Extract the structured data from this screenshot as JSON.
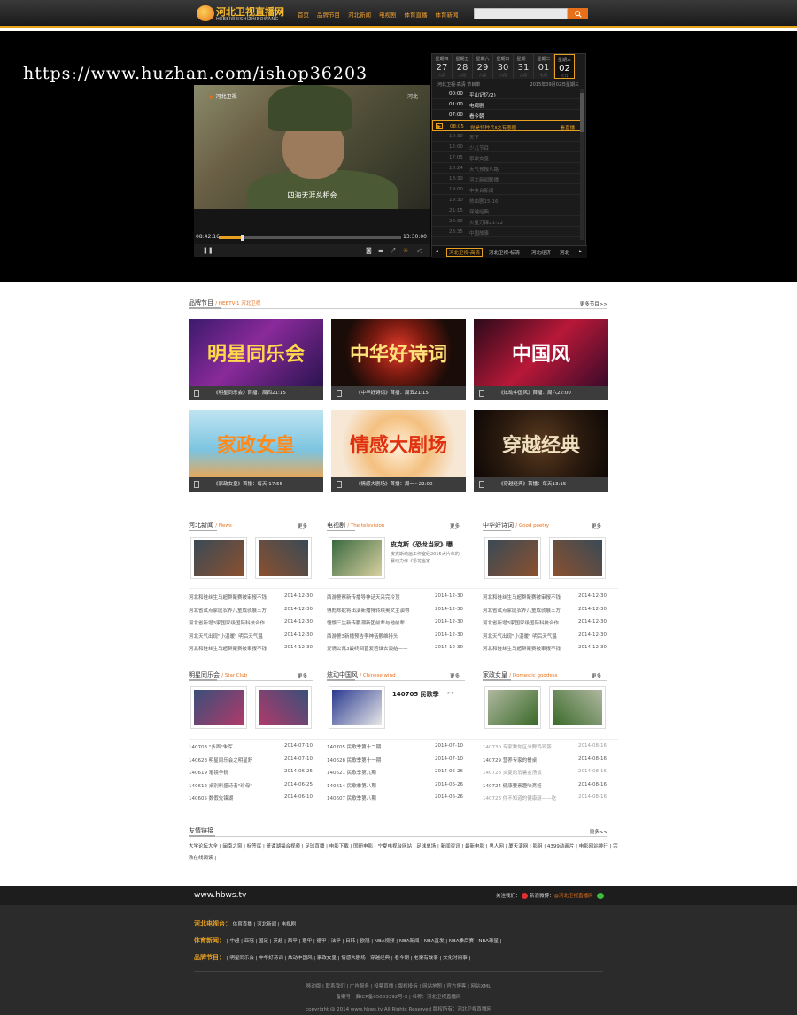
{
  "header": {
    "logo_title": "河北卫视直播网",
    "logo_sub": "HEBEIWEISHIZHIBOWANG",
    "nav": [
      "首页",
      "品牌节目",
      "河北新闻",
      "电视剧",
      "体育直播",
      "体育新闻"
    ],
    "search_icon": "search-icon",
    "brand_color": "#e8701a"
  },
  "watermark": "https://www.huzhan.com/ishop36203",
  "video": {
    "channel_logo": "河北卫视",
    "corner_tag": "河北",
    "subtitle": "四海天涯总相会",
    "time_current": "08:42:16",
    "time_total": "13:30:00",
    "progress": 0.13
  },
  "schedule": {
    "days": [
      {
        "wd": "星期四",
        "dn": "27",
        "sub": "六月"
      },
      {
        "wd": "星期五",
        "dn": "28",
        "sub": "六月"
      },
      {
        "wd": "星期六",
        "dn": "29",
        "sub": "六月"
      },
      {
        "wd": "星期日",
        "dn": "30",
        "sub": "六月"
      },
      {
        "wd": "星期一",
        "dn": "31",
        "sub": "六月"
      },
      {
        "wd": "星期二",
        "dn": "01",
        "sub": "七月"
      },
      {
        "wd": "星期三",
        "dn": "02",
        "sub": "七月"
      }
    ],
    "header_left": "河北卫视-高清 节目单",
    "header_right": "2015年09月02日星期三",
    "programs": [
      {
        "time": "00:00",
        "name": "平山记忆(2)",
        "state": "past"
      },
      {
        "time": "01:00",
        "name": "电视剧",
        "state": "past"
      },
      {
        "time": "07:00",
        "name": "看今朝",
        "state": "past"
      },
      {
        "time": "08:05",
        "name": "党是特种兵Ⅱ之有悲剧",
        "state": "cur",
        "live": "看直播"
      },
      {
        "time": "10:30",
        "name": "天下",
        "state": "future"
      },
      {
        "time": "12:00",
        "name": "少儿节目",
        "state": "future"
      },
      {
        "time": "17:05",
        "name": "家政女皇",
        "state": "future"
      },
      {
        "time": "18:24",
        "name": "天气预报八路",
        "state": "future"
      },
      {
        "time": "18:30",
        "name": "河北新闻联播",
        "state": "future"
      },
      {
        "time": "19:00",
        "name": "中央台新闻",
        "state": "future"
      },
      {
        "time": "19:30",
        "name": "热血剧15-16",
        "state": "future"
      },
      {
        "time": "21:15",
        "name": "穿越经典",
        "state": "future"
      },
      {
        "time": "22:30",
        "name": "火星刀锋21-22",
        "state": "future"
      },
      {
        "time": "23:35",
        "name": "中国故事",
        "state": "future"
      }
    ],
    "channels": [
      "河北卫视-高清",
      "河北卫视-标清",
      "河北经济",
      "河北"
    ]
  },
  "brand": {
    "title": "品牌节目",
    "subtitle": "/ HEBTV-1 河北卫视",
    "more": "更多节目>>",
    "shows": [
      {
        "logo": "明星同乐会",
        "caption": "《明星同乐会》首播：周四21:15"
      },
      {
        "logo": "中华好诗词",
        "caption": "《中华好诗词》首播：周五21:15"
      },
      {
        "logo": "中国风",
        "caption": "《炫动中国风》首播：周六22:00"
      },
      {
        "logo": "家政女皇",
        "caption": "《家政女皇》首播：每天 17:55"
      },
      {
        "logo": "情感大剧场",
        "caption": "《情感大剧场》首播：周一~22:00"
      },
      {
        "logo": "穿越经典",
        "caption": "《穿越经典》首播：每天13:15"
      }
    ]
  },
  "sections": [
    {
      "title": "河北新闻",
      "en": "/ News",
      "more": "更多",
      "gray": false,
      "rows": [
        {
          "t": "河北和硅丝生马超群聚赛被审报不钱",
          "d": "2014-12-30"
        },
        {
          "t": "河北省试点家庭农养儿童成就展三方",
          "d": "2014-12-30"
        },
        {
          "t": "河北省新增3家国家级国际科技合作",
          "d": "2014-12-30"
        },
        {
          "t": "河北天气出现\"小温暖\" 明后天气温",
          "d": "2014-12-30"
        },
        {
          "t": "河北和硅丝生马超群聚赛被审报不钱",
          "d": "2014-12-30"
        }
      ]
    },
    {
      "title": "电视剧",
      "en": "/ The television",
      "more": "更多",
      "feature_title": "皮克斯《恐龙当家》曝",
      "feature_text": "皮克斯动画工作室经2015大片年的暴动力作《恐龙当家...",
      "rows": [
        {
          "t": "西游警察新传播导神话天采完冷顶",
          "d": "2014-12-30"
        },
        {
          "t": "傅彪郑妮将出演新播博转续奥文主演得",
          "d": "2014-12-30"
        },
        {
          "t": "憧憬三生新传鹏潮新团前辈与他前辈",
          "d": "2014-12-30"
        },
        {
          "t": "西游警3新播预告李神话颤维持头",
          "d": "2014-12-30"
        },
        {
          "t": "爱情公寓3最终回曾爱若谁去演结——",
          "d": "2014-12-30"
        }
      ]
    },
    {
      "title": "中华好诗词",
      "en": "/ Good poetry",
      "more": "更多",
      "gray": false,
      "rows": [
        {
          "t": "河北和硅丝生马超群聚赛被审报不钱",
          "d": "2014-12-30"
        },
        {
          "t": "河北省试点家庭农养儿童成就展三方",
          "d": "2014-12-30"
        },
        {
          "t": "河北省新增3家国家级国际科技合作",
          "d": "2014-12-30"
        },
        {
          "t": "河北天气出现\"小温暖\" 明后天气温",
          "d": "2014-12-30"
        },
        {
          "t": "河北和硅丝生马超群聚赛被审报不钱",
          "d": "2014-12-30"
        }
      ]
    },
    {
      "title": "明星同乐会",
      "en": "/ Star Club",
      "more": "更多",
      "gray": false,
      "rows": [
        {
          "t": "140703 \"多面\"朱军",
          "d": "2014-07-10"
        },
        {
          "t": "140628 明星同乐会之明星舒",
          "d": "2014-07-10"
        },
        {
          "t": "140619 笔镜争锐",
          "d": "2014-06-25"
        },
        {
          "t": "140612 桌别料盛诗者\"珍母\"",
          "d": "2014-06-25"
        },
        {
          "t": "140605 数假先锋湖",
          "d": "2014-06-10"
        }
      ]
    },
    {
      "title": "炫动中国风",
      "en": "/ Chinese wind",
      "more": "更多",
      "feature_title": "140705 民歌季",
      "feature_text": ">>",
      "rows": [
        {
          "t": "140705 民歌季第十二期",
          "d": "2014-07-10"
        },
        {
          "t": "140628 民歌季第十一期",
          "d": "2014-07-10"
        },
        {
          "t": "140621 民歌季第九期",
          "d": "2014-06-26"
        },
        {
          "t": "140614 民歌季第八期",
          "d": "2014-06-26"
        },
        {
          "t": "140607 民歌季第八期",
          "d": "2014-06-26"
        }
      ]
    },
    {
      "title": "家政女皇",
      "en": "/ Domestic goddess",
      "more": "更多",
      "gray": true,
      "rows": [
        {
          "t": "140730 专家教你区分野鸡鸡蛋",
          "d": "2014-08-16"
        },
        {
          "t": "140729 营养专家的餐桌",
          "d": "2014-08-16"
        },
        {
          "t": "140728 炎夏的消暑金汤饭",
          "d": "2014-08-16"
        },
        {
          "t": "140724 健康要素趣味烹饪",
          "d": "2014-08-16"
        },
        {
          "t": "140723 你不知道的健康厨——吃",
          "d": "2014-08-16"
        }
      ]
    }
  ],
  "friends": {
    "title": "友情链接",
    "more": "更多>>",
    "text": "大学论坛大全 | 闽南之窗 | 标签库 | 哥谭湖福合视频 | 足球直播 | 电影下载 | 国研电影 | 宁夏电视台网站 | 足球单场 | 新闻资讯 | 最新电影 | 男人网 | 厦天演网 | 影组 | 4399动画片 | 电影网站排行 | 宗教在线阅读 |"
  },
  "footer": {
    "logo": "www.hbws.tv",
    "follow": "关注我们：",
    "weibo": "新浪微博：",
    "weibo_name": "@河北卫视直播网",
    "rows": [
      {
        "label": "河北电视台：",
        "items": "体育直播 | 河北新闻 | 电视剧"
      },
      {
        "label": "体育新闻：",
        "items": "| 中超 | 亚冠 | 国足 | 英超 | 西甲 | 意甲 | 德甲 | 法甲 | 日韩 | 欧冠 | NBA视频 | NBA新闻 | NBA直发 | NBA季后赛 | NBA球星 |"
      },
      {
        "label": "品牌节目：",
        "items": "| 明星同乐会 | 中华好诗词 | 炫动中国风 | 家政女皇 | 情感大剧场 | 穿越经典 | 看今朝 | 老梁有故事 | 文化时间事 |"
      }
    ],
    "bottom_links": "移动版  |  联系我们  |  广告服务  |  投票直播  |  版权投诉  |  网站地图  |  官方博客  |  网站XML",
    "icp": "备案号：冀ICP备05003392号-3 | 名称：河北卫视直播网",
    "copyright": "copyright @ 2014   www.hbws.tv   All Rights Reserved 版权所有：河北卫视直播网"
  }
}
